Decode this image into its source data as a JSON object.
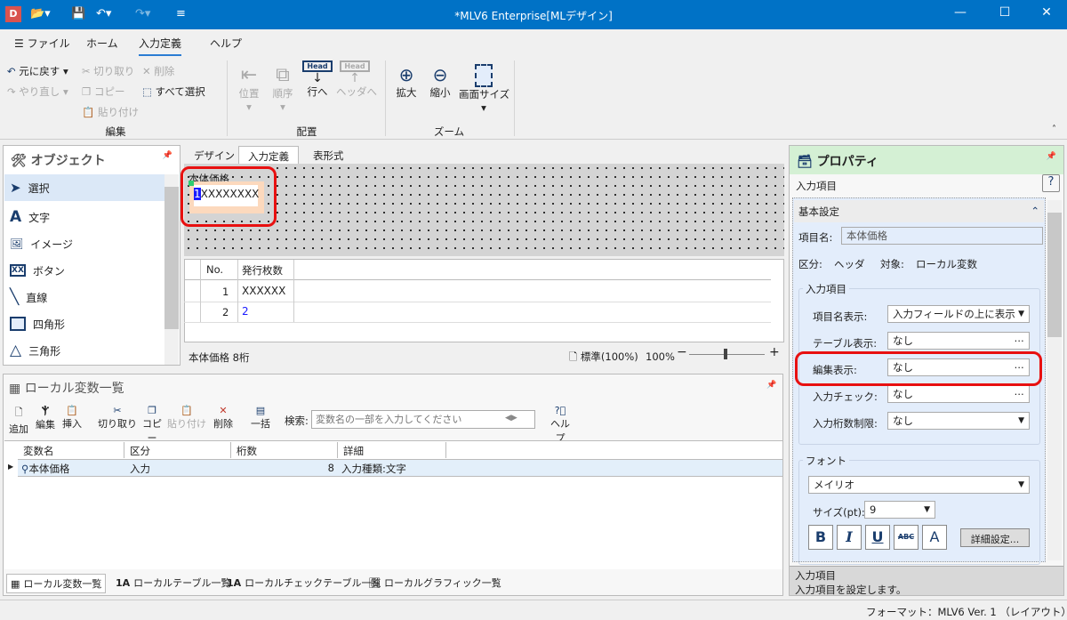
{
  "window": {
    "title": "*MLV6 Enterprise[MLデザイン]",
    "app_icon": "D"
  },
  "ribbon": {
    "tabs": [
      "ファイル",
      "ホーム",
      "入力定義",
      "ヘルプ"
    ],
    "active_tab": "入力定義",
    "edit": {
      "undo": "元に戻す",
      "redo": "やり直し",
      "cut": "切り取り",
      "copy": "コピー",
      "paste": "貼り付け",
      "delete": "削除",
      "select_all": "すべて選択",
      "group": "編集"
    },
    "layout": {
      "position": "位置",
      "order": "順序",
      "to_row": "行へ",
      "to_header": "ヘッダへ",
      "group": "配置",
      "head_icon": "Head"
    },
    "zoom": {
      "zoom_in": "拡大",
      "zoom_out": "縮小",
      "screen_size": "画面サイズ",
      "group": "ズーム"
    }
  },
  "objects": {
    "title": "オブジェクト",
    "items": [
      "選択",
      "文字",
      "イメージ",
      "ボタン",
      "直線",
      "四角形",
      "三角形"
    ],
    "selected": "選択"
  },
  "designer": {
    "tabs": [
      "デザイン",
      "入力定義",
      "表形式"
    ],
    "active_tab": "入力定義",
    "field_label": "本体価格",
    "field_value": "XXXXXXXX",
    "field_marker": "1",
    "grid": {
      "headers": [
        "No.",
        "発行枚数"
      ],
      "rows": [
        [
          "1",
          "XXXXXX"
        ],
        [
          "2",
          "2"
        ]
      ]
    },
    "status": {
      "left": "本体価格 8桁",
      "zoom_mode": "標準(100%)",
      "zoom": "100%"
    }
  },
  "localvars": {
    "title": "ローカル変数一覧",
    "toolbar": [
      "追加",
      "編集",
      "挿入",
      "切り取り",
      "コピー",
      "貼り付け",
      "削除",
      "一括",
      "ヘルプ"
    ],
    "search_label": "検索:",
    "search_placeholder": "変数名の一部を入力してください",
    "headers": [
      "変数名",
      "区分",
      "桁数",
      "詳細"
    ],
    "rows": [
      [
        "本体価格",
        "入力",
        "8",
        "入力種類:文字"
      ]
    ],
    "bottom_tabs": [
      "ローカル変数一覧",
      "ローカルテーブル一覧",
      "ローカルチェックテーブル一覧",
      "ローカルグラフィック一覧"
    ]
  },
  "properties": {
    "title": "プロパティ",
    "subtitle": "入力項目",
    "section": "基本設定",
    "name_label": "項目名:",
    "name_value": "本体価格",
    "kubun_label": "区分:",
    "kubun_value": "ヘッダ",
    "target_label": "対象:",
    "target_value": "ローカル変数",
    "input_group": "入力項目",
    "fields": [
      {
        "label": "項目名表示:",
        "value": "入力フィールドの上に表示",
        "type": "dropdown"
      },
      {
        "label": "テーブル表示:",
        "value": "なし",
        "type": "ellipsis"
      },
      {
        "label": "編集表示:",
        "value": "なし",
        "type": "ellipsis"
      },
      {
        "label": "入力チェック:",
        "value": "なし",
        "type": "ellipsis"
      },
      {
        "label": "入力桁数制限:",
        "value": "なし",
        "type": "dropdown"
      }
    ],
    "font_group": "フォント",
    "font_value": "メイリオ",
    "size_label": "サイズ(pt):",
    "size_value": "9",
    "style_buttons": [
      "B",
      "I",
      "U",
      "ABC",
      "A"
    ],
    "detail_button": "詳細設定...",
    "help_title": "入力項目",
    "help_text": "入力項目を設定します。"
  },
  "statusbar": {
    "text": "フォーマット：MLV6 Ver. 1 （レイアウト）"
  },
  "colors": {
    "titlebar": "#0072c6",
    "highlight": "#e81010",
    "prop_header": "#d4f0d4",
    "prop_bg": "#e3edfb"
  }
}
